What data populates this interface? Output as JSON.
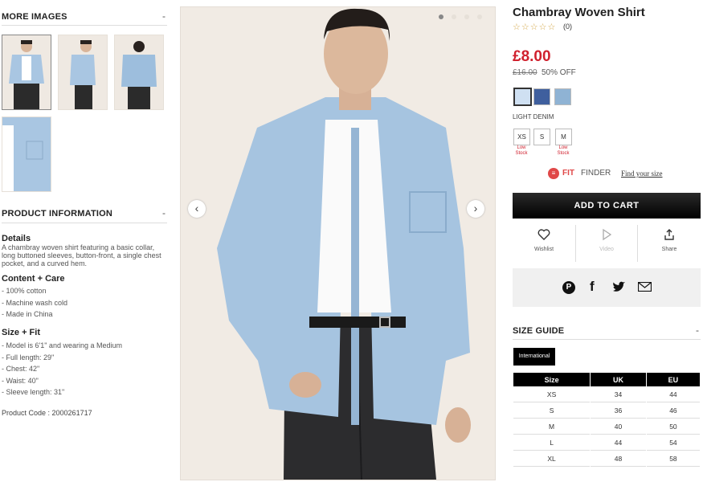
{
  "more_images": {
    "heading": "MORE IMAGES",
    "toggle": "-"
  },
  "product_info": {
    "heading": "PRODUCT INFORMATION",
    "toggle": "-",
    "details_title": "Details",
    "details_text": "A chambray woven shirt featuring a basic collar, long buttoned sleeves, button-front, a single chest pocket, and a curved hem.",
    "content_title": "Content + Care",
    "content_items": [
      "- 100% cotton",
      "- Machine wash cold",
      "- Made in China"
    ],
    "size_title": "Size + Fit",
    "size_items": [
      "- Model is 6'1\" and wearing a Medium",
      "- Full length: 29\"",
      "- Chest: 42\"",
      "- Waist: 40\"",
      "- Sleeve length: 31\""
    ],
    "product_code": "Product Code : 2000261717"
  },
  "gallery": {
    "active_dot": 1,
    "dot_count": 4
  },
  "product": {
    "title": "Chambray Woven Shirt",
    "stars": "☆☆☆☆☆",
    "review_count": "(0)",
    "price": "£8.00",
    "old_price": "£16.00",
    "discount": "50% OFF",
    "swatch_colors": [
      "#cfe0f2",
      "#3f5f9e",
      "#8fb3d4"
    ],
    "color_name": "LIGHT DENIM",
    "sizes": [
      {
        "label": "XS",
        "stock": "Low Stock"
      },
      {
        "label": "S",
        "stock": ""
      },
      {
        "label": "M",
        "stock": "Low Stock"
      }
    ],
    "fit_finder": {
      "brand_fit": "FIT",
      "brand_finder": "FINDER",
      "link": "Find your size"
    },
    "add_to_cart": "ADD TO CART",
    "actions": {
      "wishlist": "Wishlist",
      "video": "Video",
      "share": "Share"
    }
  },
  "size_guide": {
    "heading": "SIZE GUIDE",
    "toggle": "-",
    "tab": "International",
    "columns": [
      "Size",
      "UK",
      "EU"
    ],
    "rows": [
      [
        "XS",
        "34",
        "44"
      ],
      [
        "S",
        "36",
        "46"
      ],
      [
        "M",
        "40",
        "50"
      ],
      [
        "L",
        "44",
        "54"
      ],
      [
        "XL",
        "48",
        "58"
      ]
    ]
  },
  "colors": {
    "accent_red": "#d0212e",
    "cart_bg": "#1a1a1a"
  }
}
